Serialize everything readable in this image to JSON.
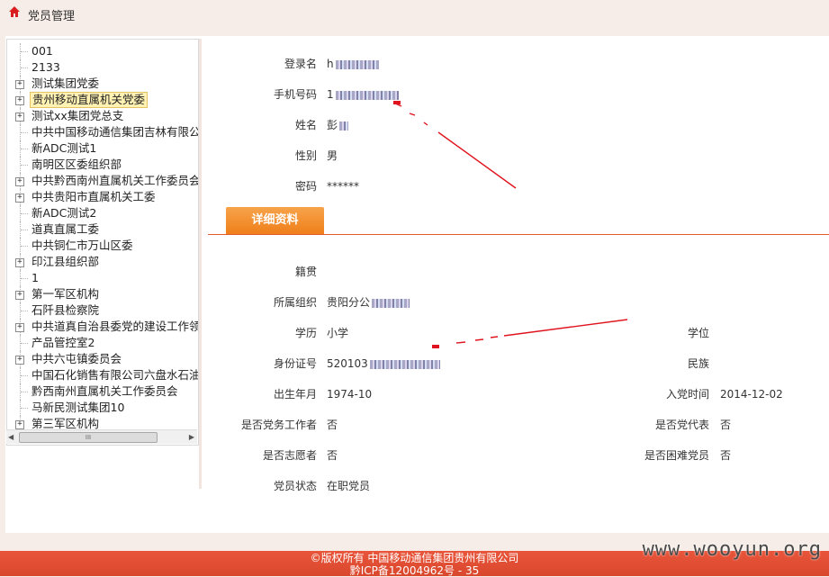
{
  "header": {
    "title": "党员管理",
    "icon": "home-icon"
  },
  "tree": {
    "items": [
      {
        "label": "001",
        "expandable": false
      },
      {
        "label": "2133",
        "expandable": false
      },
      {
        "label": "测试集团党委",
        "expandable": true
      },
      {
        "label": "贵州移动直属机关党委",
        "expandable": true,
        "selected": true
      },
      {
        "label": "测试xx集团党总支",
        "expandable": true
      },
      {
        "label": "中共中国移动通信集团吉林有限公司",
        "expandable": false
      },
      {
        "label": "新ADC测试1",
        "expandable": false
      },
      {
        "label": "南明区区委组织部",
        "expandable": false
      },
      {
        "label": "中共黔西南州直属机关工作委员会",
        "expandable": true
      },
      {
        "label": "中共贵阳市直属机关工委",
        "expandable": true
      },
      {
        "label": "新ADC测试2",
        "expandable": false
      },
      {
        "label": "道真直属工委",
        "expandable": false
      },
      {
        "label": "中共铜仁市万山区委",
        "expandable": false
      },
      {
        "label": "印江县组织部",
        "expandable": true
      },
      {
        "label": "1",
        "expandable": false
      },
      {
        "label": "第一军区机构",
        "expandable": true
      },
      {
        "label": "石阡县检察院",
        "expandable": false
      },
      {
        "label": "中共道真自治县委党的建设工作领导",
        "expandable": true
      },
      {
        "label": "产品管控室2",
        "expandable": false
      },
      {
        "label": "中共六屯镇委员会",
        "expandable": true
      },
      {
        "label": "中国石化销售有限公司六盘水石油分",
        "expandable": false
      },
      {
        "label": "黔西南州直属机关工作委员会",
        "expandable": false
      },
      {
        "label": "马新民测试集团10",
        "expandable": false
      },
      {
        "label": "第三军区机构",
        "expandable": true
      }
    ],
    "scroll_thumb": "III"
  },
  "basic": {
    "login_label": "登录名",
    "login_value": "h",
    "phone_label": "手机号码",
    "phone_value": "1",
    "name_label": "姓名",
    "name_value": "彭",
    "gender_label": "性别",
    "gender_value": "男",
    "password_label": "密码",
    "password_value": "******"
  },
  "tab": {
    "label": "详细资料"
  },
  "detail": {
    "native_label": "籍贯",
    "native_value": "",
    "org_label": "所属组织",
    "org_value": "贵阳分公",
    "edu_label": "学历",
    "edu_value": "小学",
    "degree_label": "学位",
    "degree_value": "",
    "id_label": "身份证号",
    "id_value": "520103",
    "ethnic_label": "民族",
    "ethnic_value": "",
    "birth_label": "出生年月",
    "birth_value": "1974-10",
    "join_label": "入党时间",
    "join_value": "2014-12-02",
    "party_worker_label": "是否党务工作者",
    "party_worker_value": "否",
    "rep_label": "是否党代表",
    "rep_value": "否",
    "volunteer_label": "是否志愿者",
    "volunteer_value": "否",
    "poor_label": "是否困难党员",
    "poor_value": "否",
    "status_label": "党员状态",
    "status_value": "在职党员"
  },
  "footer": {
    "line1": "©版权所有 中国移动通信集团贵州有限公司",
    "line2": "黔ICP备12004962号 - 35"
  },
  "watermark": "www.wooyun.org",
  "colors": {
    "accent": "#ef7f1a",
    "footer": "#e0503a",
    "annotation": "#e0141e"
  }
}
